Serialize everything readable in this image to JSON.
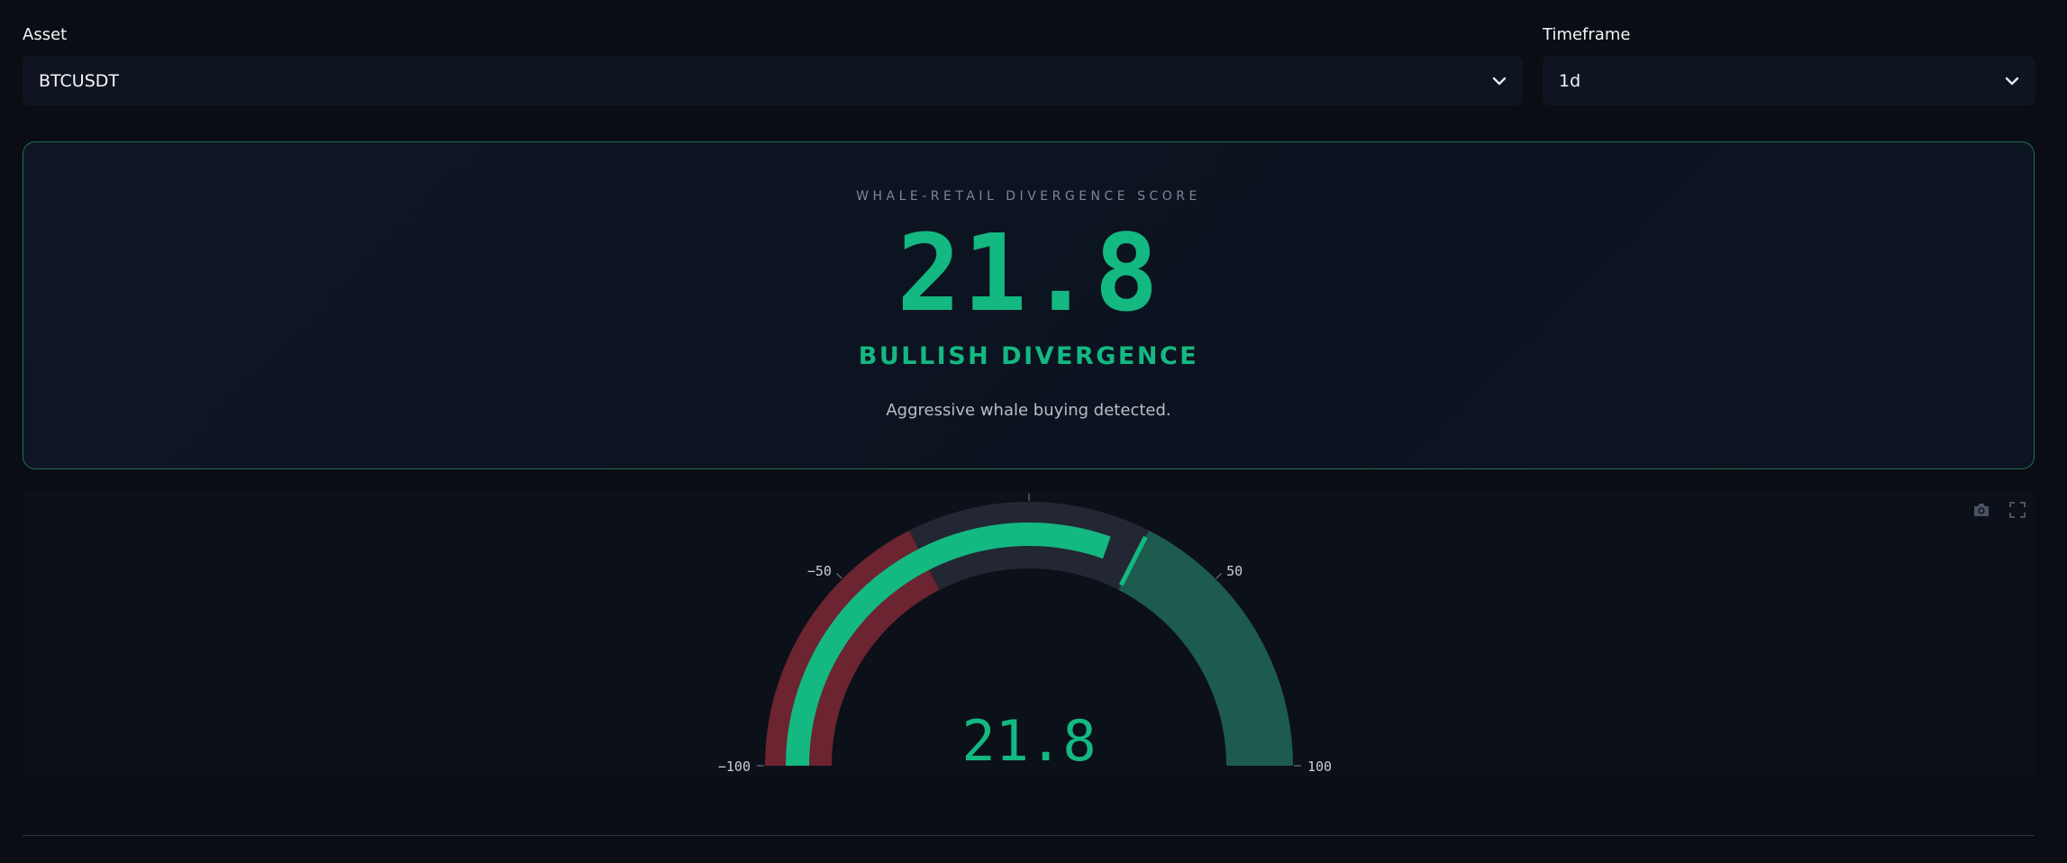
{
  "controls": {
    "asset": {
      "label": "Asset",
      "value": "BTCUSDT"
    },
    "timeframe": {
      "label": "Timeframe",
      "value": "1d"
    }
  },
  "score_card": {
    "kicker": "WHALE-RETAIL DIVERGENCE SCORE",
    "score": "21.8",
    "status": "BULLISH DIVERGENCE",
    "description": "Aggressive whale buying detected."
  },
  "chart_data": {
    "type": "gauge",
    "value": 21.8,
    "value_label": "21.8",
    "range": [
      -100,
      100
    ],
    "ticks": [
      -100,
      -50,
      0,
      50,
      100
    ],
    "tick_labels": [
      "−100",
      "−50",
      "",
      "50",
      "100"
    ],
    "steps": [
      {
        "range": [
          -100,
          -30
        ],
        "color": "#6b2430"
      },
      {
        "range": [
          -30,
          30
        ],
        "color": "#222733"
      },
      {
        "range": [
          30,
          100
        ],
        "color": "#1c5b4d"
      }
    ],
    "bar_color": "#14b881",
    "threshold": 30,
    "colors": {
      "value_text": "#14b881",
      "tick_text": "#c9ced8"
    }
  },
  "modebar": {
    "icons": [
      "camera-icon",
      "fullscreen-icon"
    ]
  }
}
